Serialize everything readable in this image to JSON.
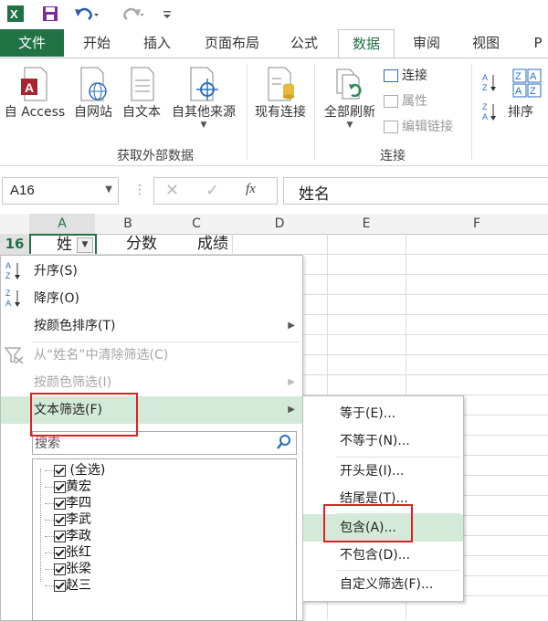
{
  "title_bar": {
    "excel_icon": "excel-logo-icon",
    "save_icon": "save-icon",
    "undo_icon": "undo-icon",
    "redo_icon": "redo-icon",
    "customize_icon": "customize-quick-access-icon"
  },
  "tabs": {
    "file": "文件",
    "items": [
      "开始",
      "插入",
      "页面布局",
      "公式",
      "数据",
      "审阅",
      "视图",
      "P"
    ],
    "active": "数据"
  },
  "ribbon": {
    "groups": {
      "get_external": {
        "label": "获取外部数据",
        "buttons": [
          "自 Access",
          "自网站",
          "自文本",
          "自其他来源"
        ]
      },
      "existing": {
        "label": "现有连接"
      },
      "connections": {
        "label": "连接",
        "refresh_all": "全部刷新",
        "connections": "连接",
        "properties": "属性",
        "edit_links": "编辑链接"
      },
      "sort": {
        "sort_label": "排序"
      }
    }
  },
  "formula_bar": {
    "name_box": "A16",
    "cancel_icon": "close-icon",
    "enter_icon": "check-icon",
    "fx_label": "fx",
    "content": "姓名"
  },
  "sheet": {
    "columns": [
      "A",
      "B",
      "C",
      "D",
      "E",
      "F"
    ],
    "row_number": "16",
    "row16": {
      "a": "姓",
      "b": "分数",
      "c": "成绩"
    }
  },
  "filter_menu": {
    "sort_asc": "升序(S)",
    "sort_desc": "降序(O)",
    "sort_by_color": "按颜色排序(T)",
    "clear_filter": "从“姓名”中清除筛选(C)",
    "filter_by_color": "按颜色筛选(I)",
    "text_filter": "文本筛选(F)",
    "search_placeholder": "搜索",
    "list": [
      "(全选)",
      "黄宏",
      "李四",
      "李武",
      "李政",
      "张红",
      "张梁",
      "赵三"
    ]
  },
  "text_filter_submenu": {
    "items": [
      "等于(E)...",
      "不等于(N)...",
      "开头是(I)...",
      "结尾是(T)...",
      "包含(A)...",
      "不包含(D)...",
      "自定义筛选(F)..."
    ],
    "highlighted": "包含(A)..."
  },
  "colors": {
    "excel_green": "#217346",
    "menu_highlight": "#d4ead9",
    "annotation_red": "#e02020"
  }
}
